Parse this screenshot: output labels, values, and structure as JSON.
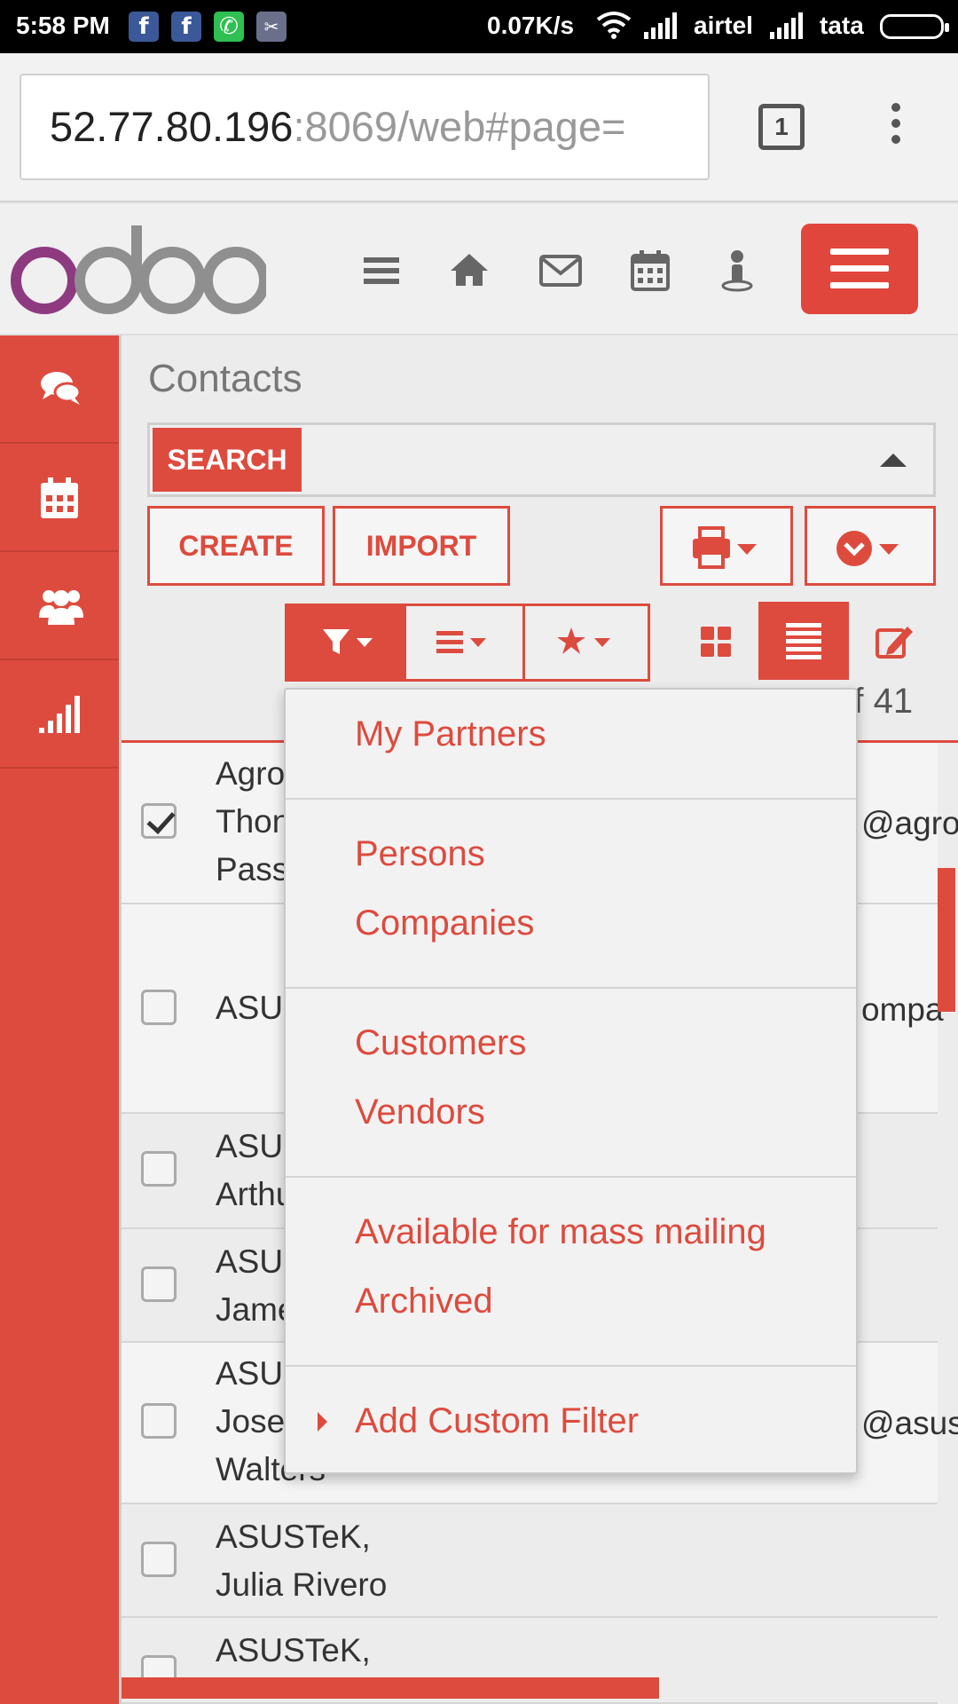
{
  "status_bar": {
    "time": "5:58 PM",
    "net_speed": "0.07K/s",
    "carrier1": "airtel",
    "carrier2": "tata",
    "notification_icons": [
      "facebook-icon",
      "facebook-icon",
      "whatsapp-icon",
      "app-icon"
    ]
  },
  "browser": {
    "url_host": "52.77.80.196",
    "url_rest": ":8069/web#page=",
    "tab_count": "1"
  },
  "header": {
    "logo_text": "odoo",
    "icons": [
      "menu-icon",
      "home-icon",
      "mail-icon",
      "calendar-icon",
      "user-icon"
    ]
  },
  "sidebar": {
    "items": [
      "chat-icon",
      "calendar-icon",
      "users-icon",
      "signal-icon"
    ]
  },
  "page": {
    "title": "Contacts",
    "search_label": "SEARCH",
    "create_label": "CREATE",
    "import_label": "IMPORT",
    "pager": "1-41 of 41"
  },
  "rows": [
    {
      "text": "Agro\nThon\nPass",
      "right": "@agro",
      "checked": true
    },
    {
      "text": "ASUS",
      "right": "ompa",
      "checked": false
    },
    {
      "text": "ASUS\nArthu",
      "right": "",
      "checked": false
    },
    {
      "text": "ASUS\nJame",
      "right": "",
      "checked": false
    },
    {
      "text": "ASUS\nJose\nWalters",
      "right": "@asus",
      "checked": false
    },
    {
      "text": "ASUSTeK,\nJulia Rivero",
      "right": "",
      "checked": false
    },
    {
      "text": "ASUSTeK,",
      "right": "",
      "checked": false
    }
  ],
  "filter_menu": {
    "groups": [
      [
        "My Partners"
      ],
      [
        "Persons",
        "Companies"
      ],
      [
        "Customers",
        "Vendors"
      ],
      [
        "Available for mass mailing",
        "Archived"
      ]
    ],
    "custom_filter": "Add Custom Filter"
  },
  "colors": {
    "accent": "#dd4b3e",
    "logo_purple": "#8e3a80",
    "logo_gray": "#8f8f8f"
  }
}
